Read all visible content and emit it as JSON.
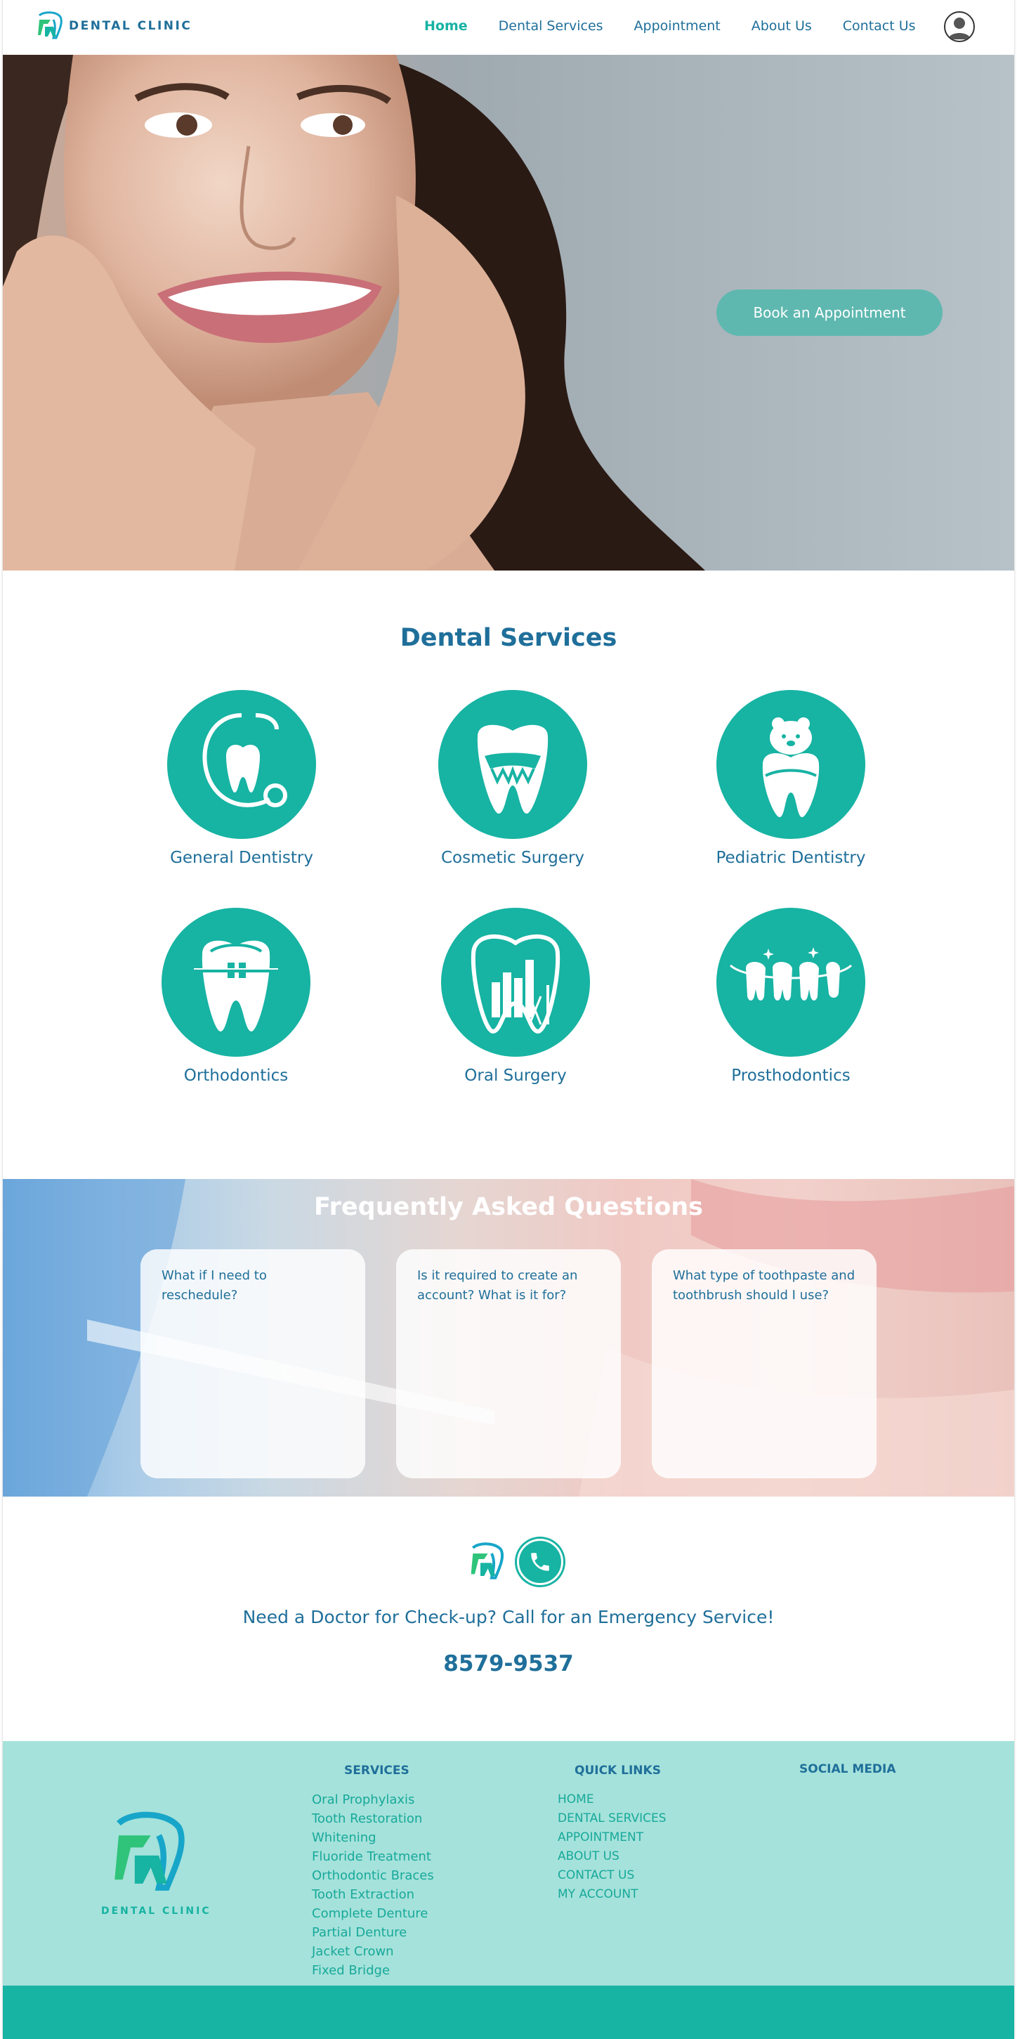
{
  "nav": {
    "brand": "DENTAL CLINIC",
    "links": [
      "Home",
      "Dental Services",
      "Appointment",
      "About Us",
      "Contact Us"
    ]
  },
  "hero": {
    "cta": "Book an Appointment"
  },
  "services": {
    "title": "Dental Services",
    "items": [
      {
        "label": "General Dentistry",
        "icon": "stethoscope-tooth-icon"
      },
      {
        "label": "Cosmetic Surgery",
        "icon": "cosmetic-tooth-icon"
      },
      {
        "label": "Pediatric Dentistry",
        "icon": "teddy-bear-tooth-icon"
      },
      {
        "label": "Orthodontics",
        "icon": "braces-tooth-icon"
      },
      {
        "label": "Oral Surgery",
        "icon": "surgery-tooth-icon"
      },
      {
        "label": "Prosthodontics",
        "icon": "denture-teeth-icon"
      }
    ]
  },
  "faq": {
    "title": "Frequently Asked Questions",
    "questions": [
      "What if I need to reschedule?",
      "Is it required to create an account? What is it for?",
      "What type of toothpaste and toothbrush should I use?"
    ]
  },
  "emergency": {
    "text": "Need a Doctor for Check-up? Call for an Emergency Service!",
    "phone": "8579-9537"
  },
  "footer": {
    "brand": "DENTAL CLINIC",
    "services_heading": "SERVICES",
    "services": [
      "Oral Prophylaxis",
      "Tooth Restoration",
      "Whitening",
      "Fluoride Treatment",
      "Orthodontic Braces",
      "Tooth Extraction",
      "Complete Denture",
      "Partial Denture",
      "Jacket Crown",
      "Fixed Bridge"
    ],
    "quicklinks_heading": "QUICK LINKS",
    "quicklinks": [
      "HOME",
      "DENTAL SERVICES",
      "APPOINTMENT",
      "ABOUT US",
      "CONTACT US",
      "MY ACCOUNT"
    ],
    "social_heading": "SOCIAL MEDIA"
  },
  "colors": {
    "primary": "#1f6f9a",
    "accent": "#17b3a3",
    "footer_bg": "#a5e2db",
    "cta": "#5fb8b0"
  }
}
